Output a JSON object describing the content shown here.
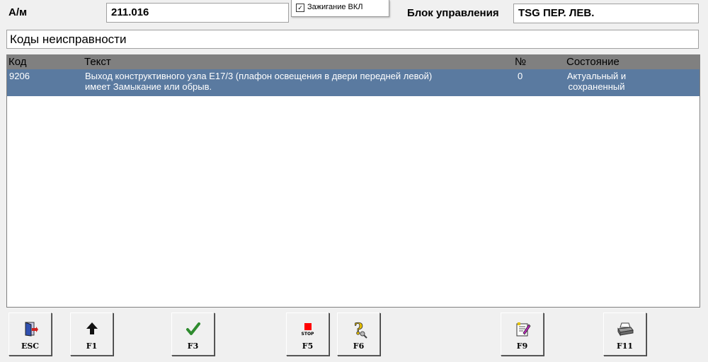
{
  "header": {
    "vehicle_label": "А/м",
    "vehicle_value": "211.016",
    "ignition_label": "Зажигание ВКЛ",
    "ignition_checked": true,
    "ecu_label": "Блок управления",
    "ecu_value": "TSG ПЕР. ЛЕВ."
  },
  "section_title": "Коды неисправности",
  "table": {
    "columns": [
      "Код",
      "Текст",
      "№",
      "Состояние"
    ],
    "rows": [
      {
        "code": "9206",
        "text_line1": "Выход конструктивного узла E17/3 (плафон освещения в двери передней левой)",
        "text_line2": "имеет Замыкание или обрыв.",
        "number": "0",
        "state_line1": "Актуальный и",
        "state_line2": "сохраненный"
      }
    ]
  },
  "toolbar": {
    "esc": {
      "label": "ESC",
      "icon": "exit-door-icon"
    },
    "f1": {
      "label": "F1",
      "icon": "arrow-up-icon"
    },
    "f3": {
      "label": "F3",
      "icon": "checkmark-icon"
    },
    "f5": {
      "label": "F5",
      "icon": "stop-icon",
      "icon_text": "STOP"
    },
    "f6": {
      "label": "F6",
      "icon": "help-icon"
    },
    "f9": {
      "label": "F9",
      "icon": "notepad-icon"
    },
    "f11": {
      "label": "F11",
      "icon": "printer-icon"
    }
  },
  "colors": {
    "selected_row": "#5a7aa0",
    "header_bg": "#808080",
    "stop_red": "#ff0000",
    "check_green": "#2e8b2e"
  }
}
